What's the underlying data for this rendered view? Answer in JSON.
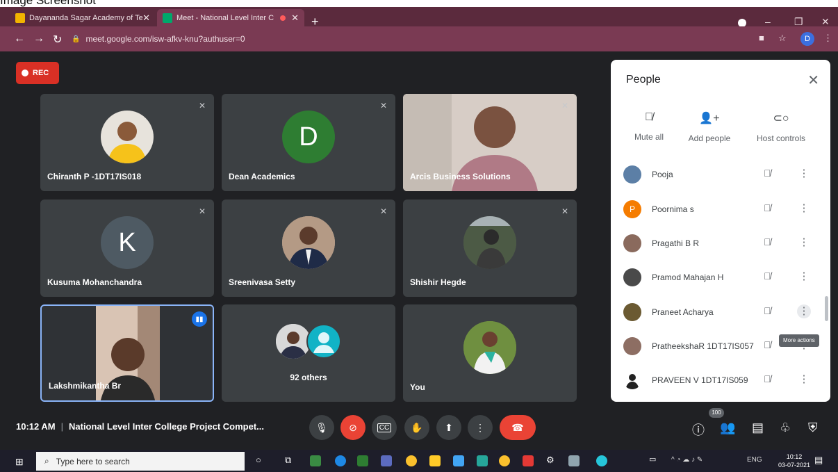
{
  "caption": "Image Screenshot",
  "browser": {
    "tabs": [
      {
        "title": "Dayananda Sagar Academy of Te",
        "active": false
      },
      {
        "title": "Meet - National Level Inter C",
        "active": true
      }
    ],
    "url": "meet.google.com/isw-afkv-knu?authuser=0",
    "profile_initial": "D"
  },
  "meeting": {
    "rec_label": "REC",
    "time": "10:12 AM",
    "title": "National Level Inter College Project Compet...",
    "participants_badge": "100"
  },
  "tiles": [
    {
      "name": "Chiranth P -1DT17IS018",
      "kind": "photo"
    },
    {
      "name": "Dean Academics",
      "kind": "letter",
      "letter": "D",
      "color": "#2e7d32"
    },
    {
      "name": "Arcis Business Solutions",
      "kind": "video"
    },
    {
      "name": "Kusuma Mohanchandra",
      "kind": "letter",
      "letter": "K",
      "color": "#4e5a63"
    },
    {
      "name": "Sreenivasa Setty",
      "kind": "photo"
    },
    {
      "name": "Shishir Hegde",
      "kind": "photo"
    },
    {
      "name": "Lakshmikantha Br",
      "kind": "video"
    },
    {
      "name": "92 others",
      "kind": "others"
    },
    {
      "name": "You",
      "kind": "photo"
    }
  ],
  "people_panel": {
    "title": "People",
    "actions": [
      {
        "label": "Mute all",
        "icon": "mic-off-icon"
      },
      {
        "label": "Add people",
        "icon": "add-person-icon"
      },
      {
        "label": "Host controls",
        "icon": "toggle-icon"
      }
    ],
    "rows": [
      {
        "name": "Pooja",
        "avatar_color": "#5c7fa6"
      },
      {
        "name": "Poornima s",
        "avatar_color": "#f57c00",
        "initial": "P"
      },
      {
        "name": "Pragathi B R",
        "avatar_color": "#8a6a5d"
      },
      {
        "name": "Pramod Mahajan H",
        "avatar_color": "#4a4a4a"
      },
      {
        "name": "Praneet Acharya",
        "avatar_color": "#6b5a32"
      },
      {
        "name": "PratheekshaR 1DT17IS057",
        "avatar_color": "#8d6e63"
      },
      {
        "name": "PRAVEEN V 1DT17IS059",
        "avatar_color": "#222"
      }
    ],
    "tooltip": "More actions"
  },
  "taskbar": {
    "search_placeholder": "Type here to search",
    "lang": "ENG",
    "clock_time": "10:12",
    "clock_date": "03-07-2021"
  },
  "colors": {
    "meet_bg": "#202124",
    "tile_bg": "#3c4043",
    "hangup": "#ea4335",
    "browser_frame": "#7a3a53"
  }
}
